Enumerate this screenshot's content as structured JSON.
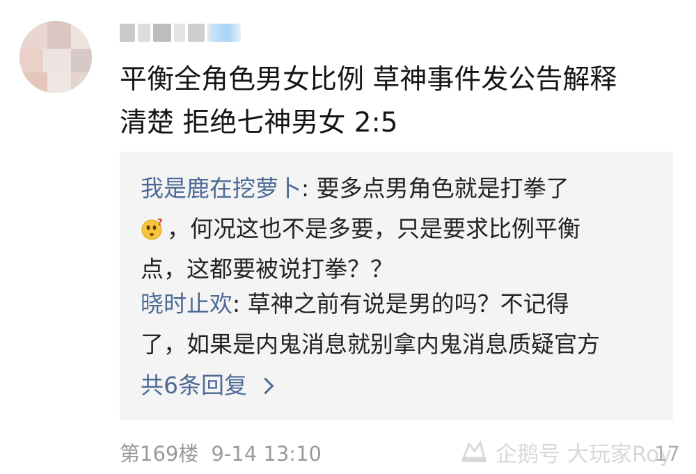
{
  "comment": {
    "lines": [
      "平衡全角色男女比例 草神事件发公告解释",
      "清楚 拒绝七神男女 2:5"
    ]
  },
  "replies": [
    {
      "user": "我是鹿在挖萝卜",
      "sep": ": ",
      "line1": "要多点男角色就是打拳了",
      "emoji": "thinking-face-emoji",
      "line2": "，何况这也不是多要，只是要求比例平衡",
      "line3": "点，这都要被说打拳？？"
    },
    {
      "user": "晓时止欢",
      "sep": ": ",
      "line1": "草神之前有说是男的吗？不记得",
      "line2": "了，如果是内鬼消息就别拿内鬼消息质疑官方"
    }
  ],
  "more_replies": "共6条回复",
  "footer": {
    "floor": "第169楼",
    "timestamp": "9-14 13:10",
    "like_count": "17"
  },
  "watermark": {
    "text": "企鹅号 大玩家Roy"
  },
  "colors": {
    "link": "#4d6a96",
    "text": "#151515",
    "reply_bg": "#f4f4f4",
    "meta": "#9a9a9a"
  }
}
